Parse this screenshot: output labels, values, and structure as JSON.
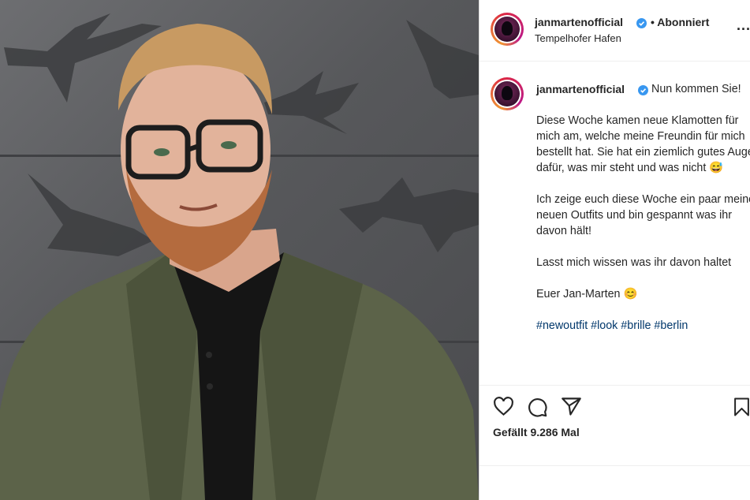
{
  "post": {
    "username": "janmartenofficial",
    "follow_status": "• Abonniert",
    "location": "Tempelhofer Hafen",
    "more_label": "...",
    "caption_lead": "Nun kommen Sie!",
    "caption_paragraphs": [
      "Diese Woche kamen neue Klamotten für mich am, welche meine Freundin für mich bestellt hat. Sie hat ein ziemlich gutes Auge dafür, was mir steht und was nicht 😅",
      "Ich zeige euch diese Woche ein paar meiner neuen Outfits und bin gespannt was ihr davon hält!",
      "Lasst mich wissen was ihr davon haltet",
      "Euer Jan-Marten 😊"
    ],
    "hashtags": "#newoutfit #look #brille #berlin",
    "likes": "Gefällt 9.286 Mal"
  },
  "icons": {
    "like": "heart-icon",
    "comment": "comment-icon",
    "share": "paper-plane-icon",
    "save": "bookmark-icon",
    "verified": "verified-badge-icon",
    "more": "more-options-icon"
  },
  "colors": {
    "verified": "#3897f0",
    "hashtag": "#00376b",
    "text": "#262626"
  }
}
